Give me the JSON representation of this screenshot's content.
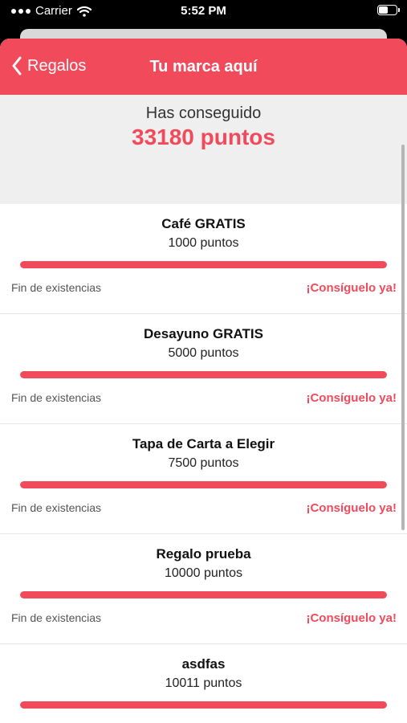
{
  "status_bar": {
    "carrier": "Carrier",
    "time": "5:52 PM",
    "battery_level": 0.6
  },
  "nav": {
    "back_label": "Regalos",
    "title": "Tu marca aquí"
  },
  "points": {
    "caption": "Has conseguido",
    "value": "33180 puntos"
  },
  "rewards": [
    {
      "name": "Café GRATIS",
      "points": "1000 puntos",
      "progress": 1.0,
      "stock": "Fin de existencias",
      "action": "¡Consíguelo ya!"
    },
    {
      "name": "Desayuno GRATIS",
      "points": "5000 puntos",
      "progress": 1.0,
      "stock": "Fin de existencias",
      "action": "¡Consíguelo ya!"
    },
    {
      "name": "Tapa de Carta a Elegir",
      "points": "7500 puntos",
      "progress": 1.0,
      "stock": "Fin de existencias",
      "action": "¡Consíguelo ya!"
    },
    {
      "name": "Regalo prueba",
      "points": "10000 puntos",
      "progress": 1.0,
      "stock": "Fin de existencias",
      "action": "¡Consíguelo ya!"
    },
    {
      "name": "asdfas",
      "points": "10011 puntos",
      "progress": 1.0,
      "stock": "",
      "action": ""
    }
  ],
  "colors": {
    "accent": "#f04a5b",
    "header_bg": "#efefef"
  },
  "icons": {
    "back": "chevron-left-icon",
    "wifi": "wifi-icon",
    "battery": "battery-icon"
  }
}
